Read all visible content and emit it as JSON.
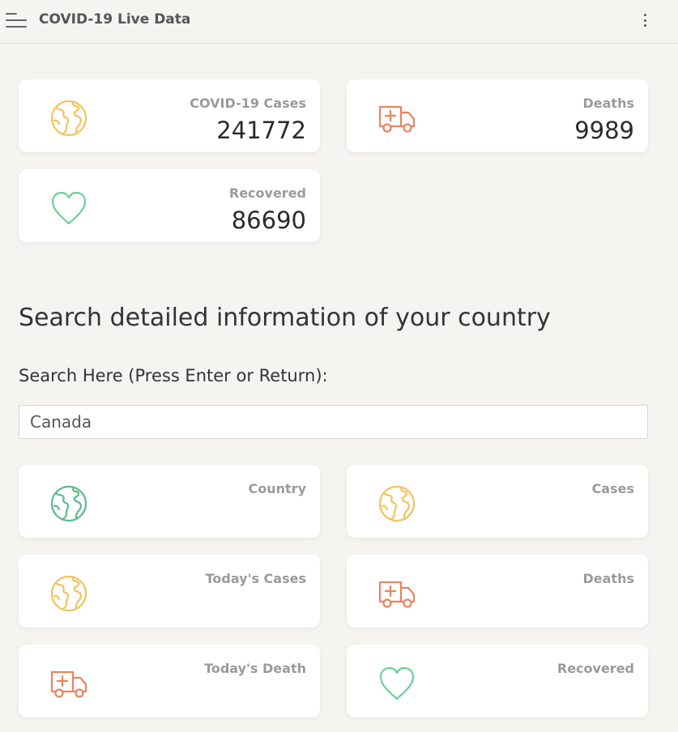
{
  "app": {
    "title": "COVID-19 Live Data"
  },
  "colors": {
    "cases": "#f2c25c",
    "deaths": "#e9845d",
    "recovered": "#6fcf97",
    "country": "#5fb98a"
  },
  "global_stats": {
    "cases": {
      "label": "COVID-19 Cases",
      "value": "241772",
      "icon": "globe-icon"
    },
    "deaths": {
      "label": "Deaths",
      "value": "9989",
      "icon": "ambulance-icon"
    },
    "recovered": {
      "label": "Recovered",
      "value": "86690",
      "icon": "heart-icon"
    }
  },
  "search": {
    "heading": "Search detailed information of your country",
    "label": "Search Here (Press Enter or Return):",
    "value": "Canada"
  },
  "country_stats": {
    "country": {
      "label": "Country",
      "icon": "globe-icon"
    },
    "cases": {
      "label": "Cases",
      "icon": "globe-icon"
    },
    "today_cases": {
      "label": "Today's Cases",
      "icon": "globe-icon"
    },
    "deaths": {
      "label": "Deaths",
      "icon": "ambulance-icon"
    },
    "today_deaths": {
      "label": "Today's Death",
      "icon": "ambulance-icon"
    },
    "recovered": {
      "label": "Recovered",
      "icon": "heart-icon"
    }
  }
}
